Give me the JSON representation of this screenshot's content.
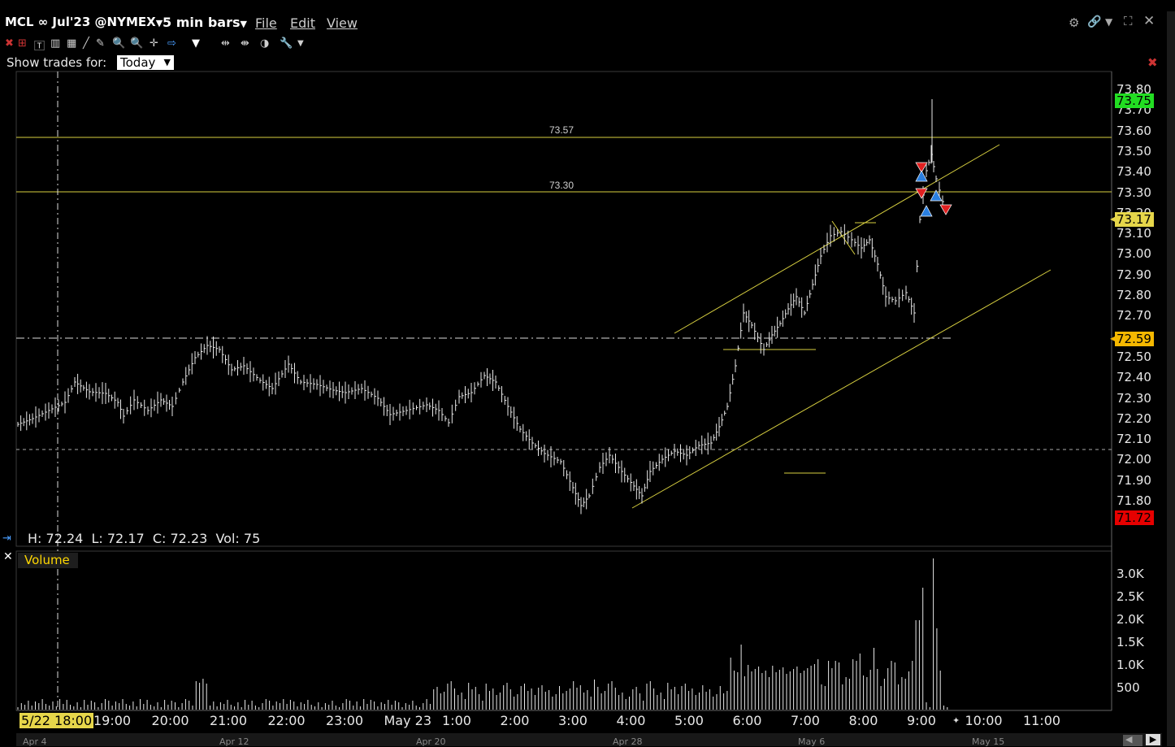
{
  "header": {
    "symbol": "MCL ∞ Jul'23 @NYMEX",
    "interval": "5 min bars",
    "menu_file": "File",
    "menu_edit": "Edit",
    "menu_view": "View"
  },
  "filter": {
    "label": "Show trades for:",
    "value": "Today"
  },
  "price_axis": {
    "ticks": [
      "73.80",
      "73.70",
      "73.60",
      "73.50",
      "73.40",
      "73.30",
      "73.20",
      "73.10",
      "73.00",
      "72.90",
      "72.80",
      "72.70",
      "72.60",
      "72.50",
      "72.40",
      "72.30",
      "72.20",
      "72.10",
      "72.00",
      "71.90",
      "71.80"
    ],
    "last_tag": "73.75",
    "current_tag": "73.17",
    "line_tag": "72.59",
    "low_tag": "71.72",
    "colors": {
      "last": "#22dd22",
      "current": "#e6d64a",
      "line": "#f5b800",
      "low": "#e60000"
    }
  },
  "level_lines": {
    "upper": "73.57",
    "lower": "73.30"
  },
  "ohlc": {
    "text": "H: 72.24  L: 72.17  C: 72.23  Vol: 75"
  },
  "volume": {
    "label": "Volume",
    "ticks": [
      "3.0K",
      "2.5K",
      "2.0K",
      "1.5K",
      "1.0K",
      "500"
    ]
  },
  "time_axis": {
    "cursor_label": "5/22 18:00",
    "labels": [
      "19:00",
      "20:00",
      "21:00",
      "22:00",
      "23:00",
      "May 23",
      "1:00",
      "2:00",
      "3:00",
      "4:00",
      "5:00",
      "6:00",
      "7:00",
      "8:00",
      "9:00",
      "10:00",
      "11:00"
    ]
  },
  "date_axis": {
    "labels": [
      "Apr 4",
      "Apr 12",
      "Apr 20",
      "Apr 28",
      "May 6",
      "May 15"
    ]
  }
}
